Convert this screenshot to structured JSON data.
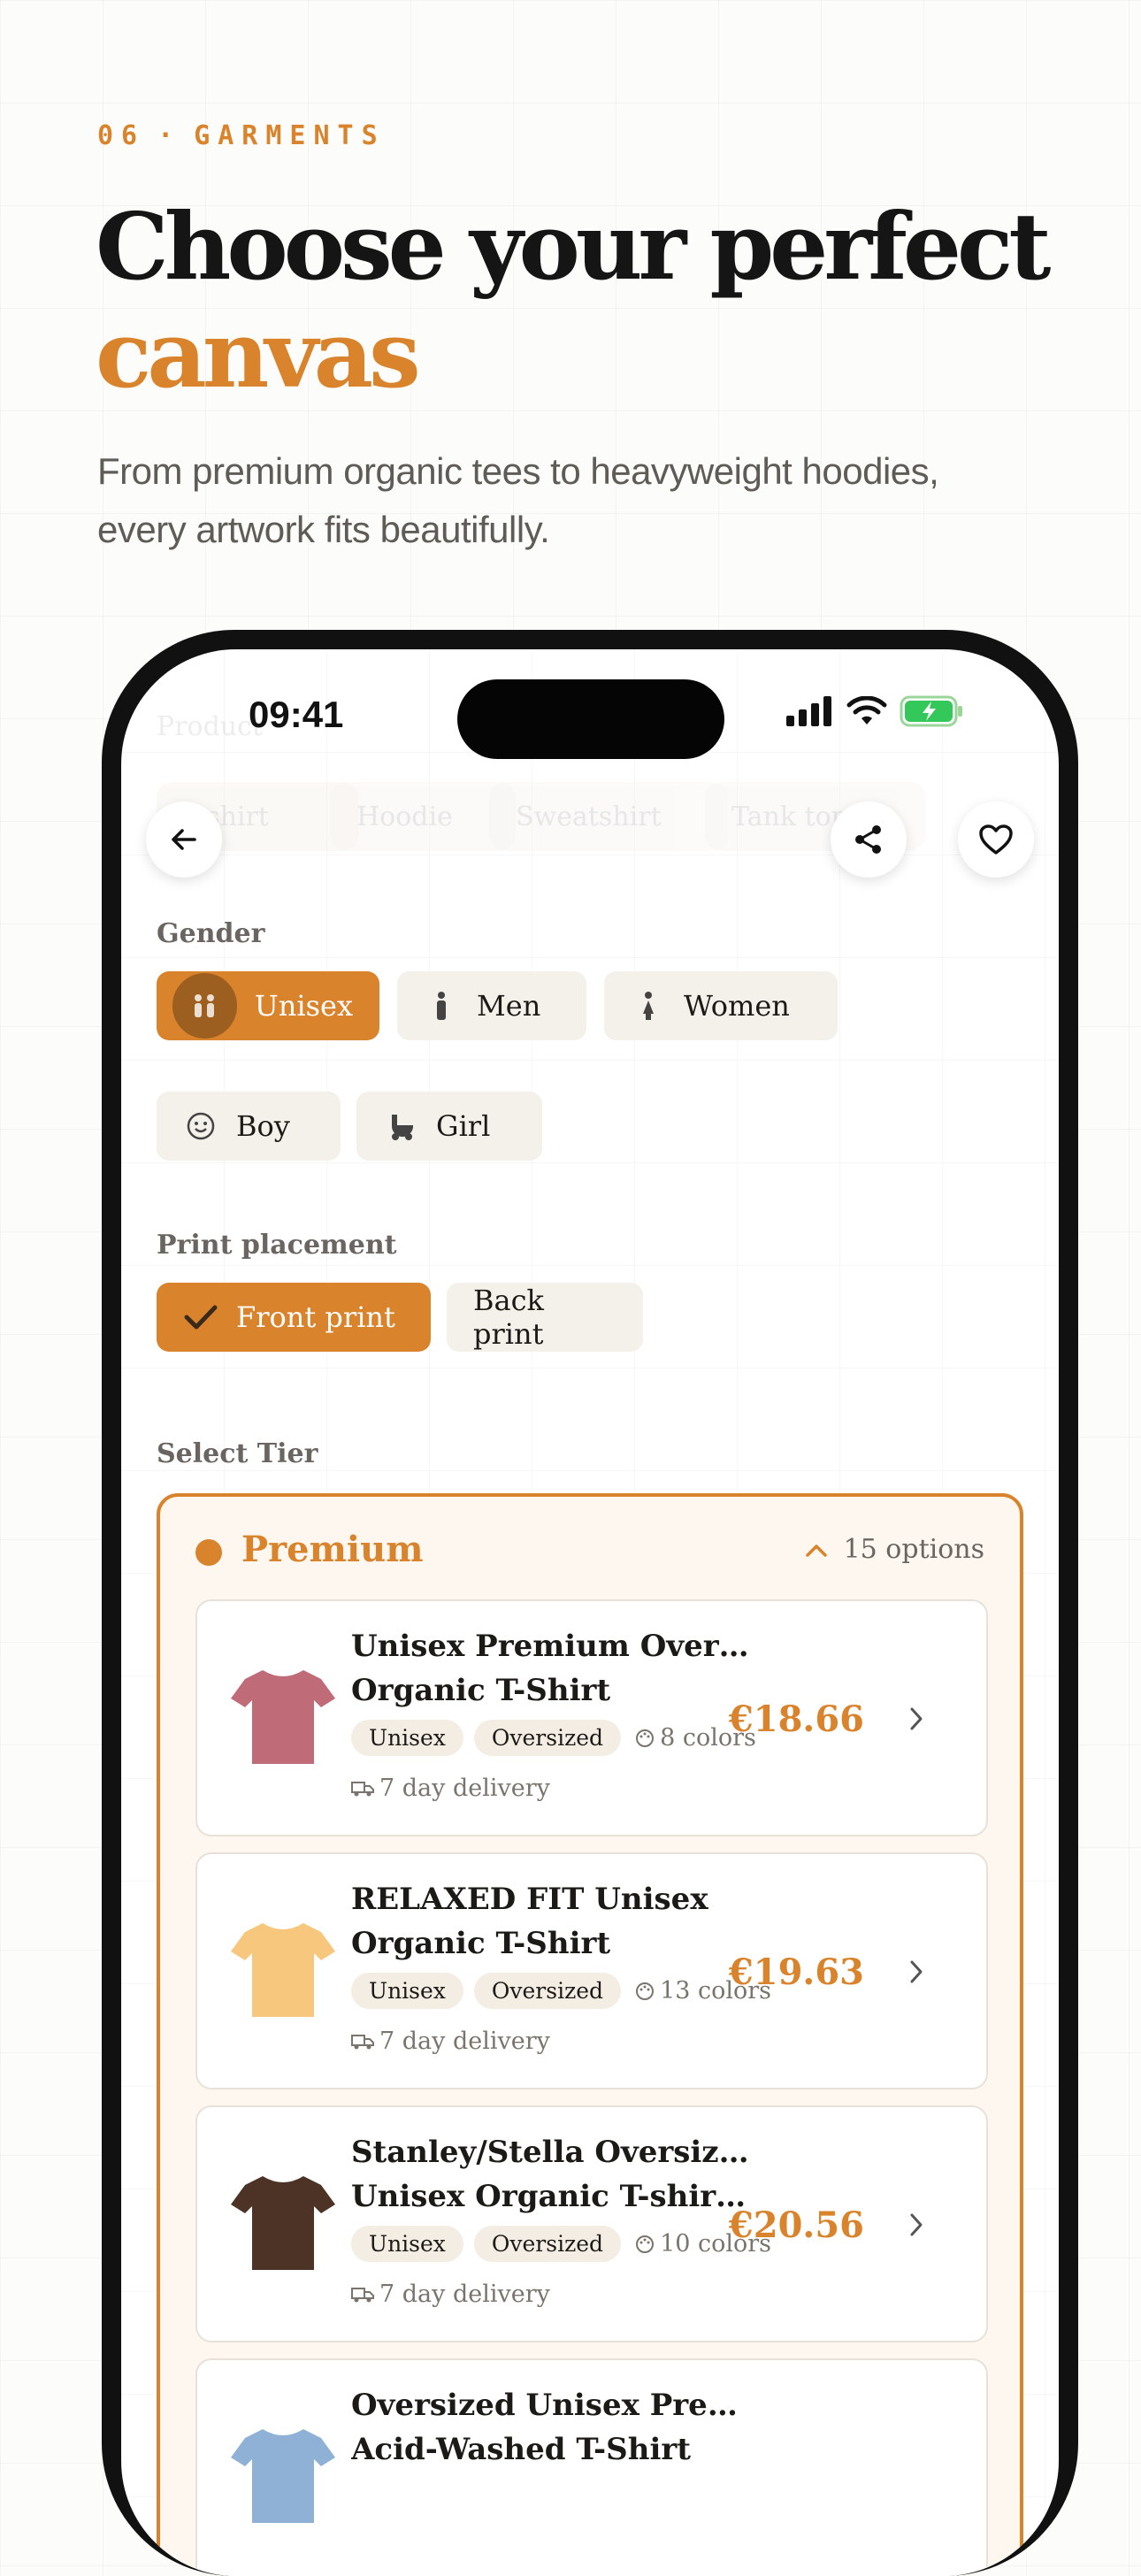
{
  "header": {
    "eyebrow_number": "06",
    "eyebrow_dot": "·",
    "eyebrow_label": "GARMENTS",
    "title_line1": "Choose your perfect",
    "title_line2": "canvas",
    "subtitle": "From premium organic tees to heavyweight hoodies, every artwork fits beautifully."
  },
  "status_bar": {
    "time": "09:41"
  },
  "ghost": {
    "label": "Product",
    "tabs": [
      "T-shirt",
      "Hoodie",
      "Sweatshirt",
      "Tank top"
    ]
  },
  "gender": {
    "label": "Gender",
    "options": [
      {
        "label": "Unisex",
        "icon": "couple-icon",
        "selected": true
      },
      {
        "label": "Men",
        "icon": "man-icon",
        "selected": false
      },
      {
        "label": "Women",
        "icon": "woman-icon",
        "selected": false
      },
      {
        "label": "Boy",
        "icon": "smiley-icon",
        "selected": false
      },
      {
        "label": "Girl",
        "icon": "stroller-icon",
        "selected": false
      }
    ]
  },
  "placement": {
    "label": "Print placement",
    "options": [
      {
        "label": "Front print",
        "selected": true
      },
      {
        "label": "Back print",
        "selected": false
      }
    ]
  },
  "tier": {
    "label": "Select Tier",
    "name": "Premium",
    "options_count": "15 options"
  },
  "products": [
    {
      "name_line1": "Unisex Premium Oversized",
      "name_line2": "Organic T-Shirt",
      "tags": [
        "Unisex",
        "Oversized"
      ],
      "colors": "8 colors",
      "delivery": "7 day delivery",
      "price": "€18.66",
      "shirt_color": "#c06b78"
    },
    {
      "name_line1": "RELAXED FIT Unisex",
      "name_line2": "Organic T-Shirt",
      "tags": [
        "Unisex",
        "Oversized"
      ],
      "colors": "13 colors",
      "delivery": "7 day delivery",
      "price": "€19.63",
      "shirt_color": "#f7c77e"
    },
    {
      "name_line1": "Stanley/Stella Oversized",
      "name_line2": "Unisex Organic T-shirt Bl...",
      "tags": [
        "Unisex",
        "Oversized"
      ],
      "colors": "10 colors",
      "delivery": "7 day delivery",
      "price": "€20.56",
      "shirt_color": "#4d3325"
    },
    {
      "name_line1": "Oversized Unisex Premium",
      "name_line2": "Acid-Washed T-Shirt",
      "tags": [],
      "colors": "",
      "delivery": "",
      "price": "",
      "shirt_color": "#8fb1d6"
    }
  ],
  "colors": {
    "accent": "#d9842c",
    "ink": "#151515"
  }
}
